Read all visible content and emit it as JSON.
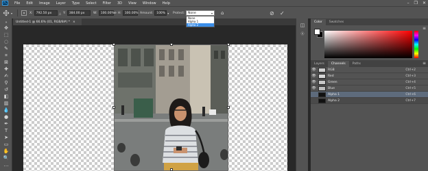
{
  "app": {
    "logo": "Ps"
  },
  "menu": [
    "File",
    "Edit",
    "Image",
    "Layer",
    "Type",
    "Select",
    "Filter",
    "3D",
    "View",
    "Window",
    "Help"
  ],
  "window_controls": {
    "minimize": "–",
    "restore": "❐",
    "close": "✕"
  },
  "options_bar": {
    "x_label": "X:",
    "x_value": "792.50 px",
    "y_label": "Y:",
    "y_value": "384.00 px",
    "w_label": "W:",
    "w_value": "100.00%",
    "h_label": "H:",
    "h_value": "100.00%",
    "amount_label": "Amount:",
    "amount_value": "100%",
    "protect_label": "Protect:",
    "protect_value": "None",
    "protect_options": [
      "None",
      "Alpha 1",
      "Alpha 2"
    ],
    "protect_highlighted": "Alpha 2"
  },
  "document": {
    "tab_title": "Untitled-1 @ 66.6% (01, RGB/8#) *",
    "tab_close": "×"
  },
  "color_panel": {
    "tabs": [
      "Color",
      "Swatches"
    ],
    "accent_fg": "#ffffff",
    "accent_bg": "#000000"
  },
  "channels_panel": {
    "tabs": [
      "Layers",
      "Channels",
      "Paths"
    ],
    "channels": [
      {
        "name": "RGB",
        "shortcut": "Ctrl+2"
      },
      {
        "name": "Red",
        "shortcut": "Ctrl+3"
      },
      {
        "name": "Green",
        "shortcut": "Ctrl+4"
      },
      {
        "name": "Blue",
        "shortcut": "Ctrl+5"
      },
      {
        "name": "Alpha 1",
        "shortcut": "Ctrl+6"
      },
      {
        "name": "Alpha 2",
        "shortcut": "Ctrl+7"
      }
    ]
  },
  "icons": {
    "tools": [
      "move-icon",
      "marquee-icon",
      "lasso-icon",
      "quick-select-icon",
      "crop-icon",
      "eyedropper-icon",
      "healing-icon",
      "brush-icon",
      "stamp-icon",
      "history-brush-icon",
      "eraser-icon",
      "gradient-icon",
      "blur-icon",
      "dodge-icon",
      "pen-icon",
      "type-icon",
      "path-select-icon",
      "shape-icon",
      "hand-icon",
      "zoom-icon"
    ]
  }
}
